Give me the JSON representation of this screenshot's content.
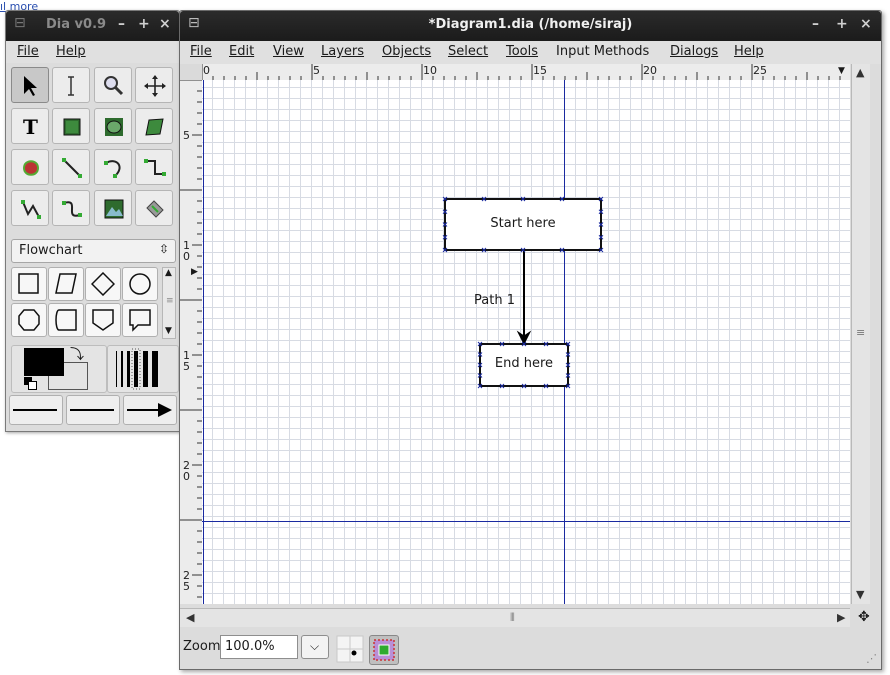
{
  "background_link": {
    "label": "more"
  },
  "toolbox": {
    "title": "Dia v0.9",
    "menu": [
      "File",
      "Help"
    ],
    "tools": [
      "pointer-tool",
      "text-edit-tool",
      "magnify-tool",
      "scroll-tool",
      "text-tool",
      "box-tool",
      "ellipse-tool",
      "polygon-tool",
      "beziergon-tool",
      "line-tool",
      "arc-tool",
      "zigzagline-tool",
      "polyline-tool",
      "bezierline-tool",
      "image-tool",
      "outline-tool"
    ],
    "sheet": "Flowchart",
    "shapes": [
      "process-shape",
      "data-shape",
      "decision-shape",
      "connector-shape",
      "preparation-shape",
      "magnetic-tape-shape",
      "offpage-connector-shape",
      "document-shape"
    ],
    "colors": {
      "foreground": "#000000",
      "background": "#ffffff"
    }
  },
  "window": {
    "title": "*Diagram1.dia (/home/siraj)",
    "menu": [
      "File",
      "Edit",
      "View",
      "Layers",
      "Objects",
      "Select",
      "Tools",
      "Input Methods",
      "Dialogs",
      "Help"
    ],
    "ruler_h": [
      "0",
      "5",
      "10",
      "15",
      "20",
      "25"
    ],
    "ruler_v": [
      "5",
      "10",
      "15",
      "20",
      "25"
    ]
  },
  "diagram": {
    "start_label": "Start here",
    "end_label": "End here",
    "path_label": "Path 1",
    "guide_color": "#1a2aa0"
  },
  "status": {
    "zoom_label": "Zoom",
    "zoom_value": "100.0%"
  }
}
